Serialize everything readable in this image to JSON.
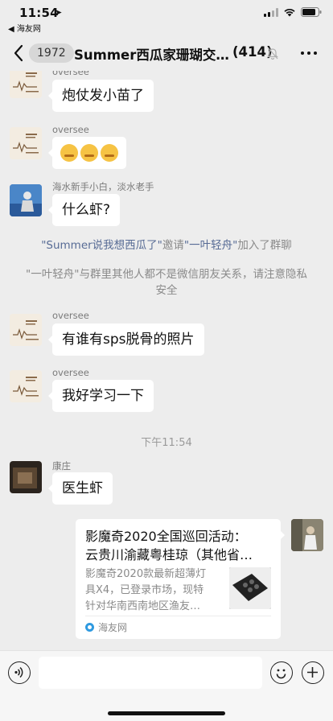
{
  "status_bar": {
    "time": "11:54",
    "back_app": "◀ 海友网"
  },
  "nav": {
    "unread_count": "1972",
    "title": "Summer西瓜家珊瑚交…",
    "member_count": "(414)"
  },
  "messages": [
    {
      "sender": "oversee",
      "text": "炮仗发小苗了"
    },
    {
      "sender": "oversee",
      "text": ""
    },
    {
      "sender": "海水新手小白，淡水老手",
      "text": "什么虾?"
    },
    {
      "sender": "oversee",
      "text": "有谁有sps脱骨的照片"
    },
    {
      "sender": "oversee",
      "text": "我好学习一下"
    },
    {
      "sender": "康庄",
      "text": "医生虾"
    }
  ],
  "system_invite": {
    "inviter": "\"Summer说我想西瓜了\"",
    "verb1": "邀请",
    "invitee": "\"一叶轻舟\"",
    "verb2": "加入了群聊"
  },
  "system_notice": "\"一叶轻舟\"与群里其他人都不是微信朋友关系，请注意隐私安全",
  "timestamp": "下午11:54",
  "link_card": {
    "title_line1": "影魔奇2020全国巡回活动：",
    "title_line2": "云贵川渝藏粤桂琼（其他省…",
    "desc_line1": "影魔奇2020款最新超薄灯",
    "desc_line2": "具X4，已登录市场，现特",
    "desc_line3": "针对华南西南地区渔友…",
    "source": "海友网"
  },
  "icons": {
    "back": "chevron-left-icon",
    "mute": "bell-off-icon",
    "more": "more-dots-icon",
    "voice": "voice-icon",
    "emoji": "smile-icon",
    "plus": "plus-icon"
  }
}
